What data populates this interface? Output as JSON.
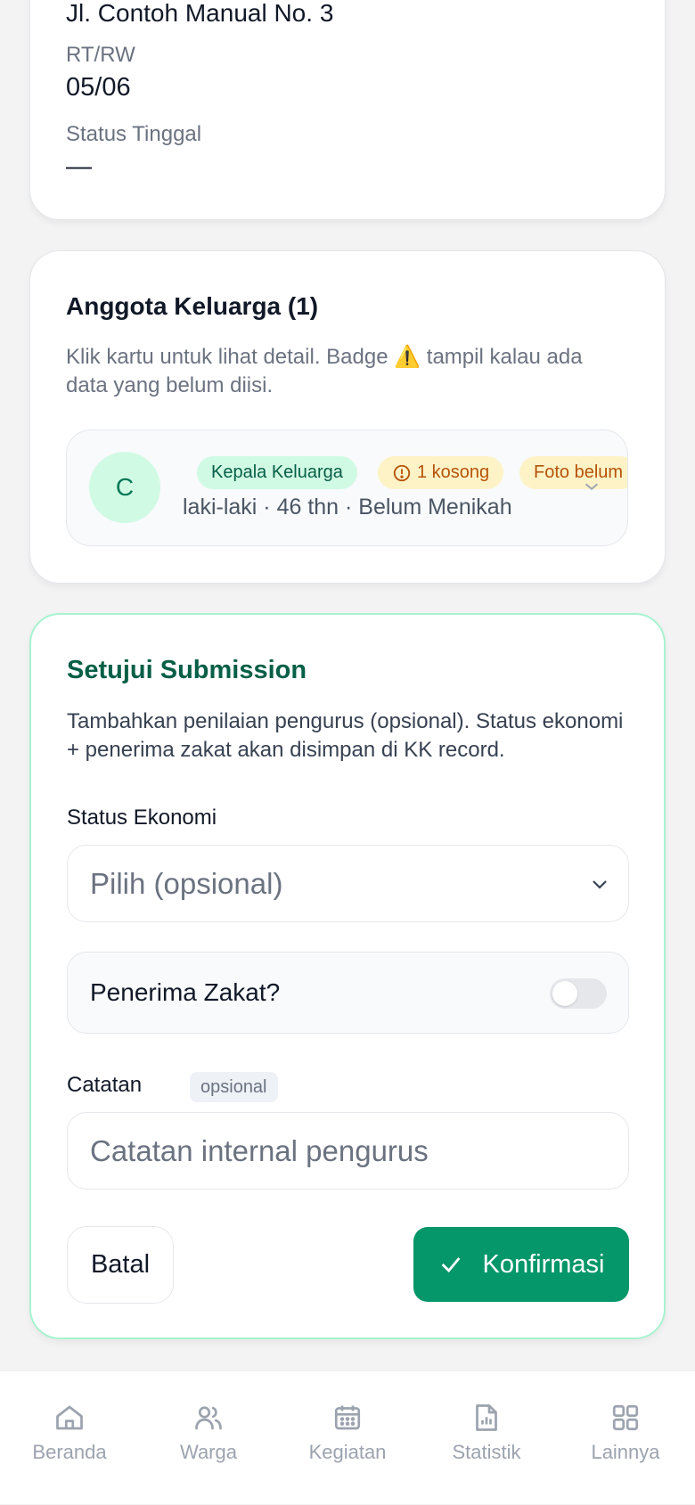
{
  "address": {
    "street": "Jl. Contoh Manual No. 3",
    "rtrw_label": "RT/RW",
    "rtrw_value": "05/06",
    "status_label": "Status Tinggal",
    "status_value": "—"
  },
  "family": {
    "title": "Anggota Keluarga (1)",
    "desc_before": "Klik kartu untuk lihat detail. Badge ",
    "desc_icon": "⚠️",
    "desc_after": " tampil kalau ada data yang belum diisi.",
    "member": {
      "initial": "C",
      "badge_role": "Kepala Keluarga",
      "badge_empty": "1 kosong",
      "badge_photo": "Foto belum",
      "meta": "laki-laki · 46 thn · Belum Menikah"
    }
  },
  "approval": {
    "title": "Setujui Submission",
    "desc": "Tambahkan penilaian pengurus (opsional). Status ekonomi + penerima zakat akan disimpan di KK record.",
    "econ_label": "Status Ekonomi",
    "econ_placeholder": "Pilih (opsional)",
    "zakat_label": "Penerima Zakat?",
    "zakat_on": false,
    "notes_label": "Catatan",
    "notes_optional": "opsional",
    "notes_placeholder": "Catatan internal pengurus",
    "cancel_label": "Batal",
    "confirm_label": "Konfirmasi"
  },
  "nav": {
    "items": [
      {
        "label": "Beranda",
        "icon": "home-icon"
      },
      {
        "label": "Warga",
        "icon": "users-icon"
      },
      {
        "label": "Kegiatan",
        "icon": "calendar-icon"
      },
      {
        "label": "Statistik",
        "icon": "report-icon"
      },
      {
        "label": "Lainnya",
        "icon": "grid-icon"
      }
    ]
  },
  "colors": {
    "accent": "#059669",
    "accent_dark": "#065f46",
    "warning": "#b45309"
  }
}
